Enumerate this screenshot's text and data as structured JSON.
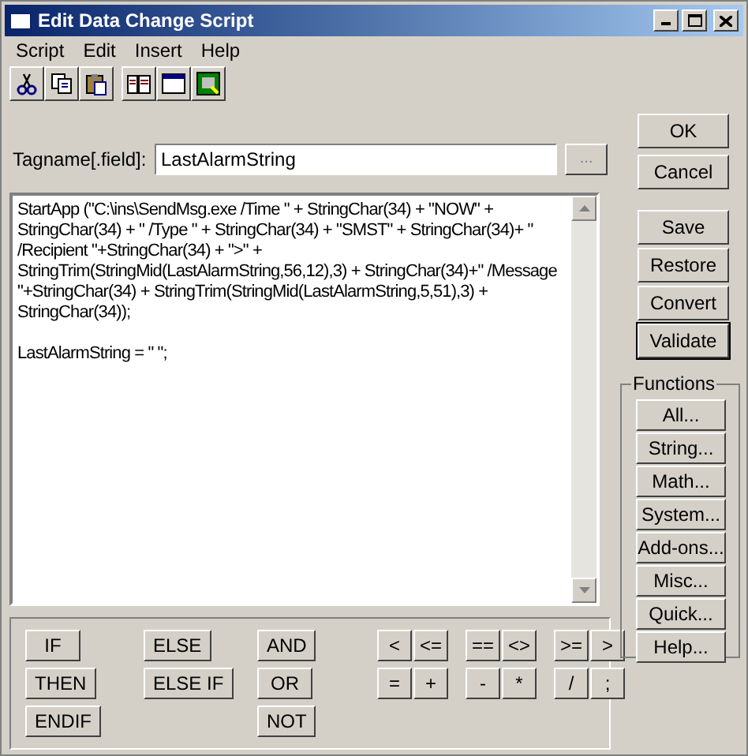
{
  "window": {
    "title": "Edit Data Change Script"
  },
  "menu": [
    "Script",
    "Edit",
    "Insert",
    "Help"
  ],
  "toolbar": [
    {
      "kind": "cut"
    },
    {
      "kind": "copy"
    },
    {
      "kind": "paste"
    },
    {
      "kind": "book"
    },
    {
      "kind": "window"
    },
    {
      "kind": "ocx"
    }
  ],
  "tagname": {
    "label": "Tagname[.field]:",
    "value": "LastAlarmString",
    "browse": "..."
  },
  "script_paragraphs": [
    [
      "StartApp (\"C:\\ins\\SendMsg.exe /Time \" + StringChar(34) + \"NOW\" +",
      "StringChar(34) + \" /Type \" + StringChar(34) + \"SMST\" + StringChar(34)+ \"",
      "/Recipient \"+StringChar(34) + \">\" +",
      "StringTrim(StringMid(LastAlarmString,56,12),3) + StringChar(34)+\" /Message",
      "\"+StringChar(34) + StringTrim(StringMid(LastAlarmString,5,51),3) +",
      "StringChar(34));"
    ],
    [
      "LastAlarmString = \" \";"
    ]
  ],
  "buttons_top": [
    {
      "label": "OK",
      "default": false
    },
    {
      "label": "Cancel",
      "default": false
    }
  ],
  "buttons_middle": [
    {
      "label": "Save",
      "default": false
    },
    {
      "label": "Restore",
      "default": false
    },
    {
      "label": "Convert",
      "default": false
    },
    {
      "label": "Validate",
      "default": true
    }
  ],
  "functions": {
    "title": "Functions",
    "buttons": [
      "All...",
      "String...",
      "Math...",
      "System...",
      "Add-ons...",
      "Misc...",
      "Quick...",
      "Help..."
    ]
  },
  "keywords": [
    [
      "IF",
      "THEN",
      "ENDIF"
    ],
    [
      "ELSE",
      "ELSE IF"
    ],
    [
      "AND",
      "OR",
      "NOT"
    ]
  ],
  "operators": [
    [
      "<",
      "<=",
      "==",
      "<>",
      ">=",
      ">"
    ],
    [
      "=",
      "+",
      "-",
      "*",
      "/",
      ";"
    ]
  ]
}
